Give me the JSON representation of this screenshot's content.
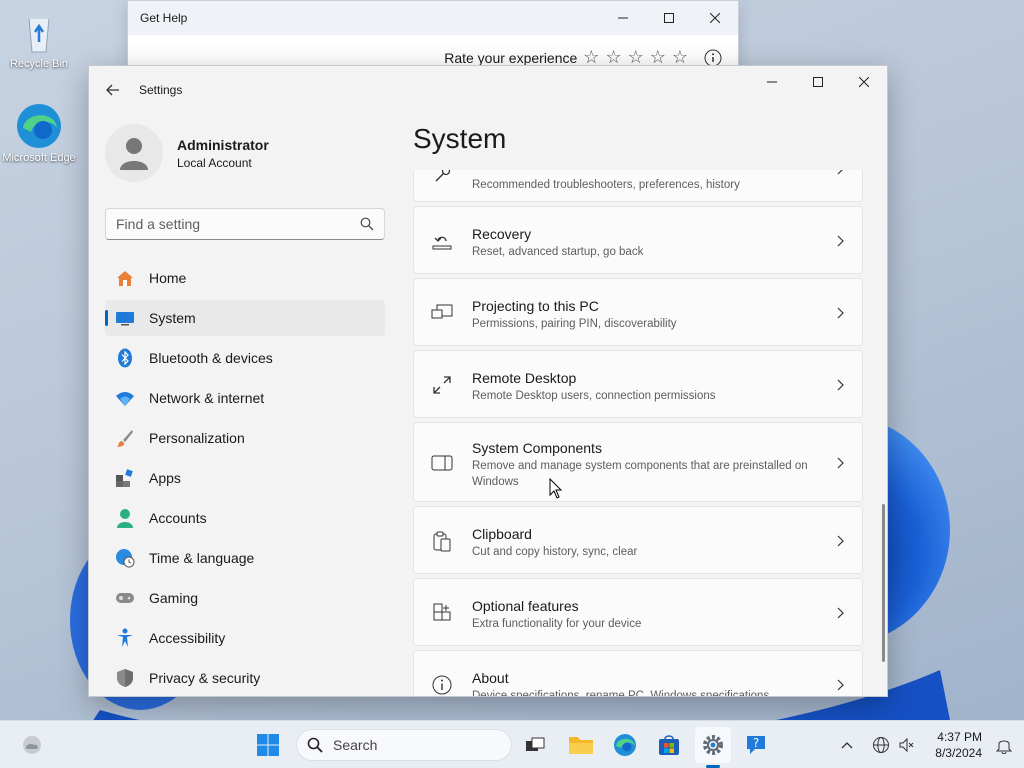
{
  "desktop": {
    "icons": [
      {
        "label": "Recycle Bin",
        "icon": "recycle-bin-icon"
      },
      {
        "label": "Microsoft Edge",
        "icon": "edge-icon"
      }
    ]
  },
  "get_help": {
    "title": "Get Help",
    "rate_label": "Rate your experience",
    "stars": [
      "☆",
      "☆",
      "☆",
      "☆",
      "☆"
    ],
    "info_icon": "info-icon"
  },
  "settings": {
    "title": "Settings",
    "user": {
      "name": "Administrator",
      "type": "Local Account"
    },
    "search": {
      "placeholder": "Find a setting"
    },
    "nav": [
      {
        "label": "Home",
        "icon": "home-icon"
      },
      {
        "label": "System",
        "icon": "system-icon",
        "active": true
      },
      {
        "label": "Bluetooth & devices",
        "icon": "bluetooth-icon"
      },
      {
        "label": "Network & internet",
        "icon": "wifi-icon"
      },
      {
        "label": "Personalization",
        "icon": "brush-icon"
      },
      {
        "label": "Apps",
        "icon": "apps-icon"
      },
      {
        "label": "Accounts",
        "icon": "accounts-icon"
      },
      {
        "label": "Time & language",
        "icon": "globe-clock-icon"
      },
      {
        "label": "Gaming",
        "icon": "gamepad-icon"
      },
      {
        "label": "Accessibility",
        "icon": "accessibility-icon"
      },
      {
        "label": "Privacy & security",
        "icon": "shield-icon"
      }
    ],
    "page_title": "System",
    "cards": [
      {
        "title": "",
        "subtitle": "Recommended troubleshooters, preferences, history",
        "icon": "troubleshoot-icon"
      },
      {
        "title": "Recovery",
        "subtitle": "Reset, advanced startup, go back",
        "icon": "recovery-icon"
      },
      {
        "title": "Projecting to this PC",
        "subtitle": "Permissions, pairing PIN, discoverability",
        "icon": "projecting-icon"
      },
      {
        "title": "Remote Desktop",
        "subtitle": "Remote Desktop users, connection permissions",
        "icon": "remote-desktop-icon"
      },
      {
        "title": "System Components",
        "subtitle": "Remove and manage system components that are preinstalled on Windows",
        "icon": "system-components-icon"
      },
      {
        "title": "Clipboard",
        "subtitle": "Cut and copy history, sync, clear",
        "icon": "clipboard-icon"
      },
      {
        "title": "Optional features",
        "subtitle": "Extra functionality for your device",
        "icon": "optional-features-icon"
      },
      {
        "title": "About",
        "subtitle": "Device specifications, rename PC, Windows specifications",
        "icon": "about-icon"
      }
    ]
  },
  "taskbar": {
    "search_label": "Search",
    "pinned": [
      "start-icon",
      "task-view-icon",
      "file-explorer-icon",
      "edge-icon",
      "store-icon",
      "settings-icon",
      "get-help-icon"
    ],
    "time": "4:37 PM",
    "date": "8/3/2024"
  },
  "colors": {
    "accent": "#0067c0",
    "window_bg": "#f3f3f3",
    "card_bg": "#fbfbfb"
  }
}
